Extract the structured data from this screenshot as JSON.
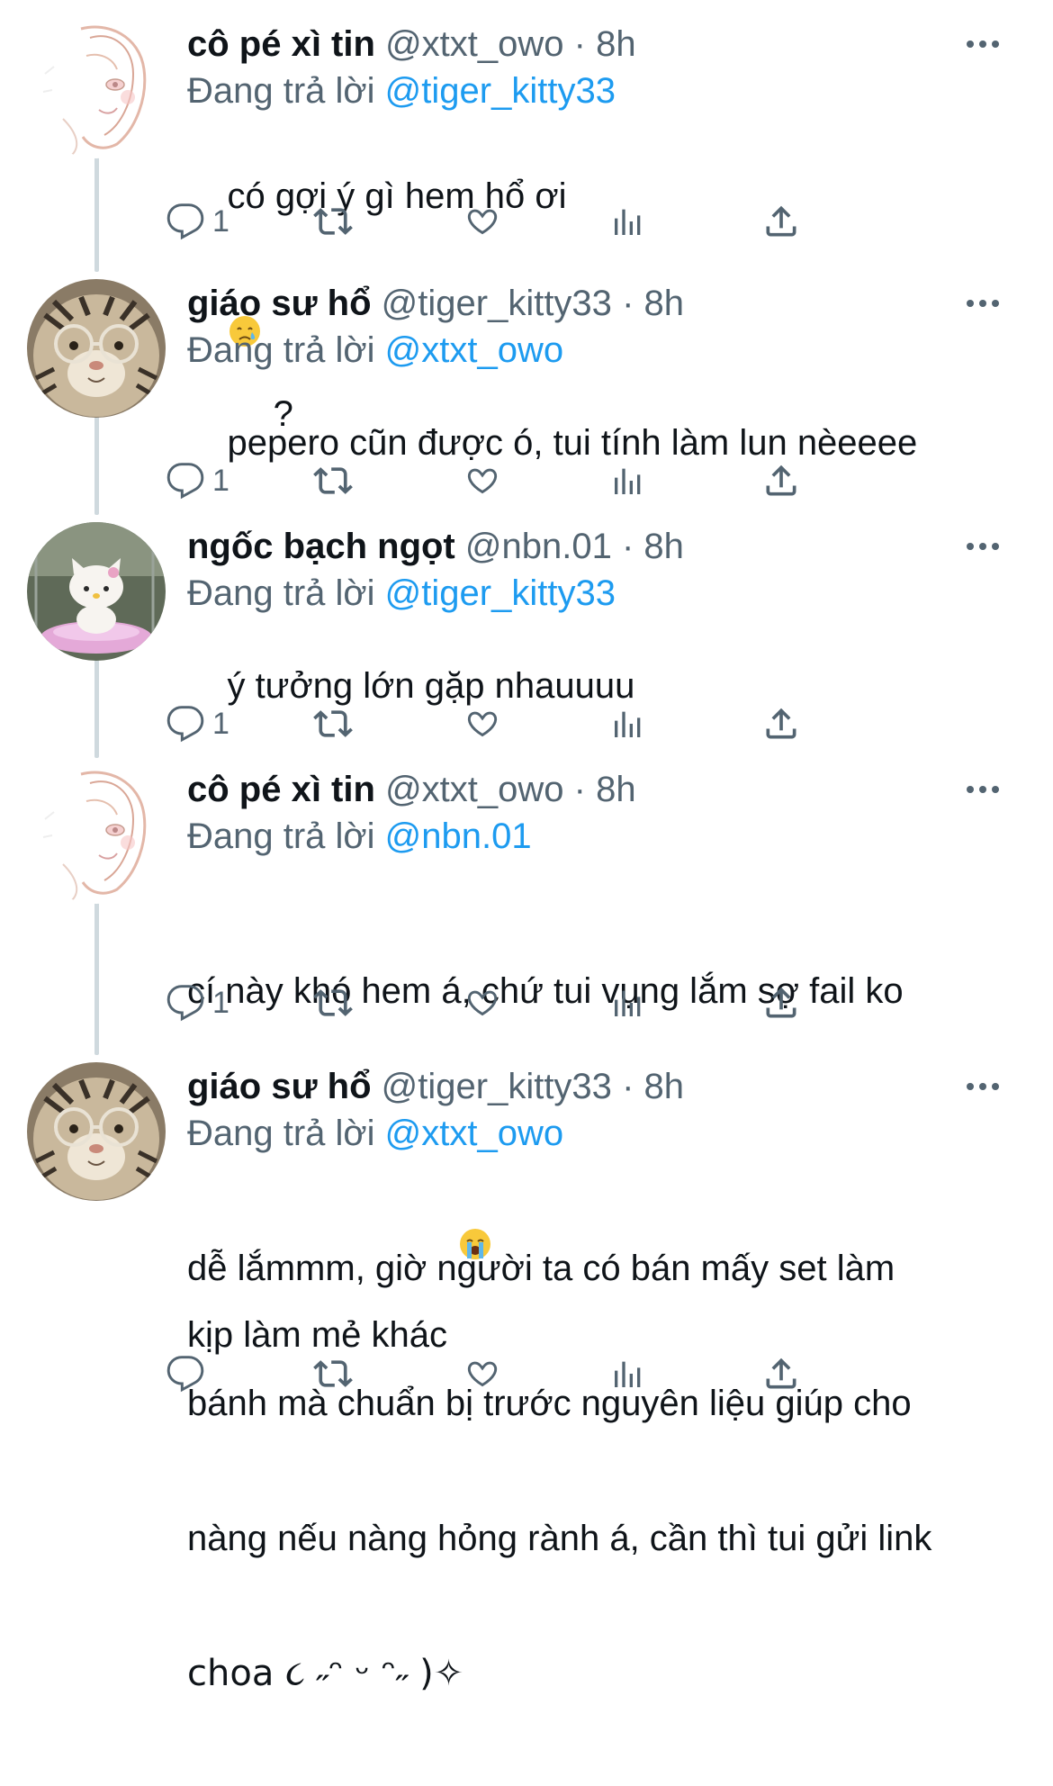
{
  "thread": [
    {
      "display_name": "cô pé xì tin",
      "handle": "@xtxt_owo",
      "time": "· 8h",
      "replying_to_label": "Đang trả lời",
      "replying_to": "@tiger_kitty33",
      "text": "có gợi ý gì hem hổ ơi",
      "text_suffix": " ?",
      "avatar_icon": "anime-girl-sketch-avatar",
      "reply_count": "1"
    },
    {
      "display_name": "giáo sư hổ",
      "handle": "@tiger_kitty33",
      "time": "· 8h",
      "replying_to_label": "Đang trả lời",
      "replying_to": "@xtxt_owo",
      "text": "pepero cũn được ó, tui tính làm lun nèeeee",
      "avatar_icon": "tiger-plush-with-glasses-avatar",
      "reply_count": "1"
    },
    {
      "display_name": "ngốc bạch ngọt",
      "handle": "@nbn.01",
      "time": "· 8h",
      "replying_to_label": "Đang trả lời",
      "replying_to": "@tiger_kitty33",
      "text": "ý tưởng lớn gặp nhauuuu",
      "avatar_icon": "hello-kitty-plush-avatar",
      "reply_count": "1"
    },
    {
      "display_name": "cô pé xì tin",
      "handle": "@xtxt_owo",
      "time": "· 8h",
      "replying_to_label": "Đang trả lời",
      "replying_to": "@nbn.01",
      "text_line1": "cí này khó hem á, chứ tui vụng lắm sợ fail ko",
      "text_line2": "kịp làm mẻ khác",
      "avatar_icon": "anime-girl-sketch-avatar",
      "reply_count": "1"
    },
    {
      "display_name": "giáo sư hổ",
      "handle": "@tiger_kitty33",
      "time": "· 8h",
      "replying_to_label": "Đang trả lời",
      "replying_to": "@xtxt_owo",
      "text_line1": "dễ lắmmm, giờ người ta có bán mấy set làm",
      "text_line2": "bánh mà chuẩn bị trước nguyên liệu giúp cho",
      "text_line3": "nàng nếu nàng hỏng rành á, cần thì tui gửi link",
      "text_line4": "choa ૮ ˶ᵔ ᵕ ᵔ˶ )✧",
      "avatar_icon": "tiger-plush-with-glasses-avatar",
      "reply_count": ""
    }
  ],
  "icons": {
    "reply": "reply-bubble-icon",
    "retweet": "retweet-icon",
    "like": "heart-icon",
    "views": "analytics-bars-icon",
    "share": "share-upload-icon",
    "more": "more-dots-icon",
    "emoji_crying": "crying-face-emoji",
    "emoji_loudly_crying": "loudly-crying-face-emoji"
  },
  "colors": {
    "link": "#1d9bf0",
    "secondary_text": "#536471",
    "thread_line": "#cfd9de"
  }
}
